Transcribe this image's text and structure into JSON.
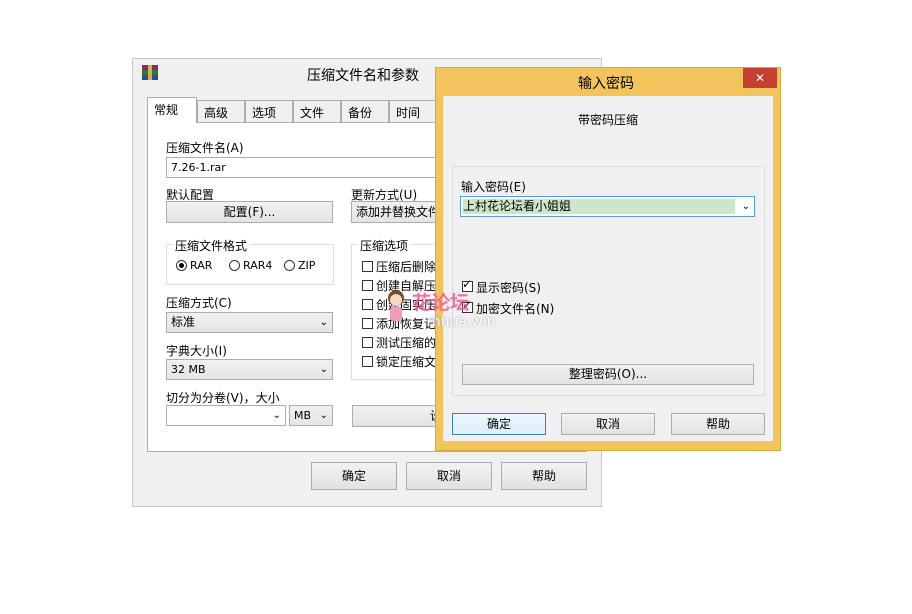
{
  "main_dialog": {
    "title": "压缩文件名和参数",
    "tabs": [
      "常规",
      "高级",
      "选项",
      "文件",
      "备份",
      "时间"
    ],
    "archive_name_label": "压缩文件名(A)",
    "archive_name_value": "7.26-1.rar",
    "default_profile_label": "默认配置",
    "profile_button": "配置(F)...",
    "update_mode_label": "更新方式(U)",
    "update_mode_value": "添加并替换文件",
    "archive_format_label": "压缩文件格式",
    "formats": [
      "RAR",
      "RAR4",
      "ZIP"
    ],
    "selected_format": "RAR",
    "compression_options_label": "压缩选项",
    "options": [
      "压缩后删除",
      "创建自解压",
      "创建固实压",
      "添加恢复记",
      "测试压缩的",
      "锁定压缩文"
    ],
    "compression_method_label": "压缩方式(C)",
    "compression_method_value": "标准",
    "dictionary_label": "字典大小(I)",
    "dictionary_value": "32 MB",
    "split_label": "切分为分卷(V)，大小",
    "split_unit": "MB",
    "set_password_button": "设",
    "ok": "确定",
    "cancel": "取消",
    "help": "帮助"
  },
  "password_dialog": {
    "title": "输入密码",
    "close": "✕",
    "heading": "带密码压缩",
    "password_label": "输入密码(E)",
    "password_value": "上村花论坛看小姐姐",
    "show_password": "显示密码(S)",
    "encrypt_names": "加密文件名(N)",
    "show_password_checked": true,
    "encrypt_names_checked": true,
    "organize_button": "整理密码(O)...",
    "ok": "确定",
    "cancel": "取消",
    "help": "帮助"
  },
  "watermark": {
    "text": "花论坛",
    "sub": "mhua.win"
  },
  "colors": {
    "password_titlebar": "#f2c45b",
    "close_button": "#c7402f",
    "selection": "#cbe6c8"
  }
}
